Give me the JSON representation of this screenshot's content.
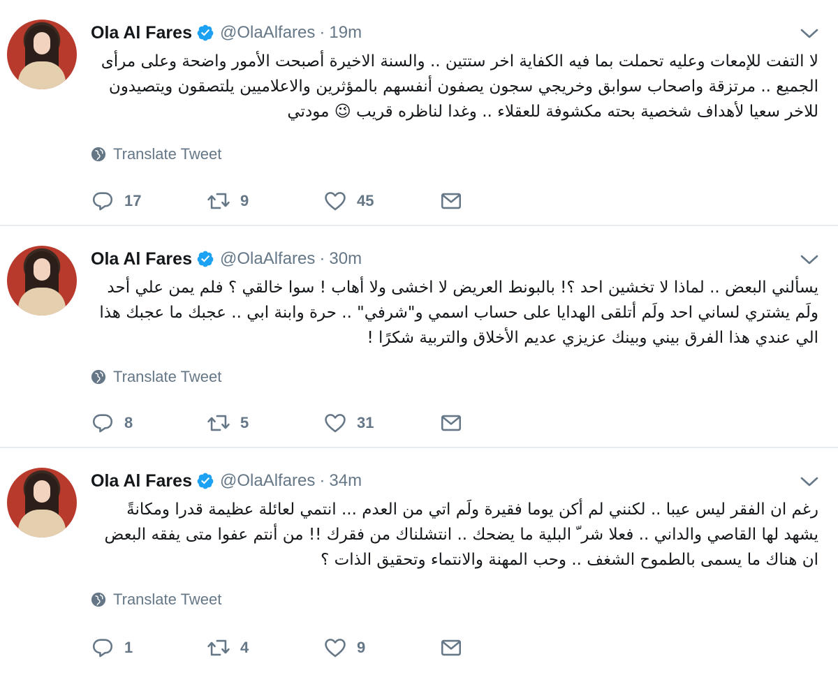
{
  "feed": {
    "tweets": [
      {
        "name": "Ola Al Fares",
        "handle": "@OlaAlfares",
        "time": "19m",
        "text": "لا التفت للإمعات وعليه تحملت بما فيه الكفاية اخر ستتين .. والسنة الاخيرة أصبحت الأمور واضحة وعلى مرأى الجميع .. مرتزقة واصحاب سوابق وخريجي سجون يصفون أنفسهم بالمؤثرين والاعلاميين يلتصقون ويتصيدون للاخر سعيا لأهداف شخصية بحته مكشوفة للعقلاء .. وغدا لناظره قريب 😉 مودتي",
        "translate_label": "Translate Tweet",
        "replies": "17",
        "retweets": "9",
        "likes": "45"
      },
      {
        "name": "Ola Al Fares",
        "handle": "@OlaAlfares",
        "time": "30m",
        "text": "يسألني البعض .. لماذا لا تخشين احد ؟! بالبونط العريض لا اخشى ولا أهاب ! سوا خالقي ؟ فلم يمن علي أحد ولَم يشتري لساني احد ولَم أتلقى الهدايا على حساب اسمي و\"شرفي\" .. حرة وابنة ابي .. عجبك ما عجبك هذا الي عندي هذا الفرق بيني وبينك عزيزي عديم الأخلاق والتربية شكرًا !",
        "translate_label": "Translate Tweet",
        "replies": "8",
        "retweets": "5",
        "likes": "31"
      },
      {
        "name": "Ola Al Fares",
        "handle": "@OlaAlfares",
        "time": "34m",
        "text": "رغم ان الفقر ليس عيبا .. لكنني لم أكن يوما فقيرة ولَم اتي من العدم ... انتمي لعائلة عظيمة قدرا ومكانةً يشهد لها القاصي والداني .. فعلا شر ّ البلية ما يضحك .. انتشلناك من فقرك !! من أنتم عفوا متى يفقه البعض ان هناك ما يسمى بالطموح الشغف .. وحب المهنة والانتماء وتحقيق الذات ؟",
        "translate_label": "Translate Tweet",
        "replies": "1",
        "retweets": "4",
        "likes": "9"
      }
    ]
  },
  "colors": {
    "text": "#14171a",
    "muted": "#657786",
    "verified": "#1da1f2",
    "divider": "#e6ecf0"
  },
  "icons": {
    "verified": "verified-badge-icon",
    "chevron": "chevron-down-icon",
    "globe": "globe-icon",
    "reply": "reply-icon",
    "retweet": "retweet-icon",
    "like": "heart-icon",
    "dm": "envelope-icon"
  }
}
